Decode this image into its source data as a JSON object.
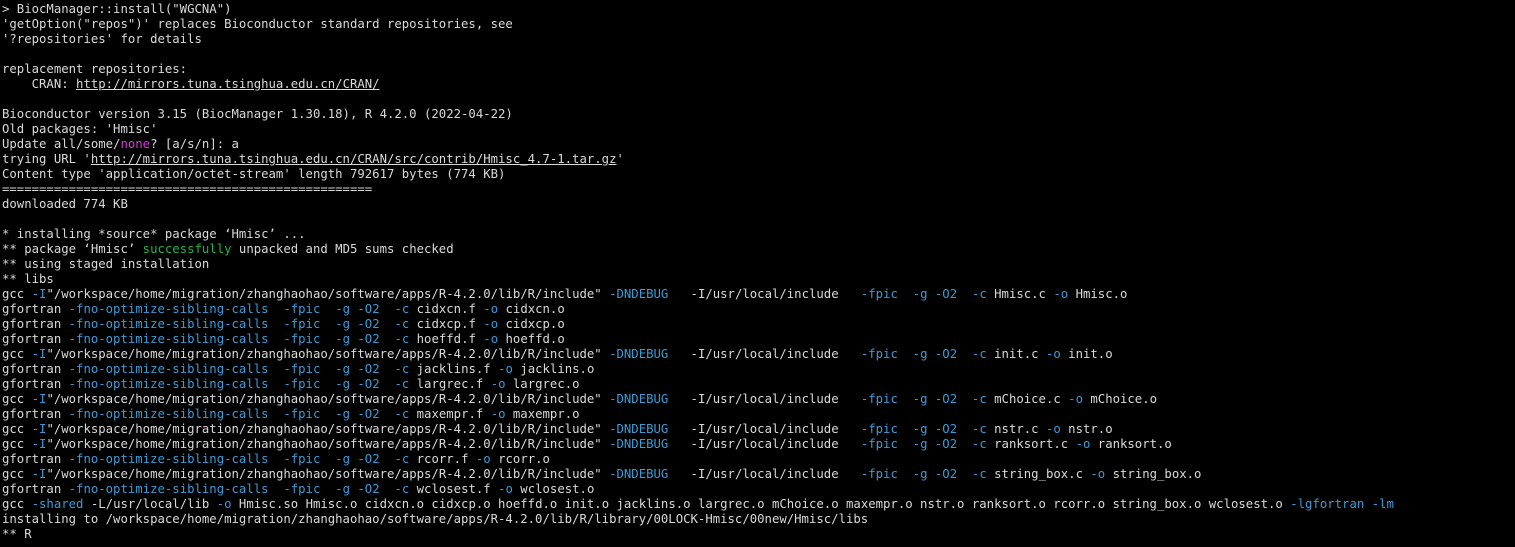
{
  "colors": {
    "background": "#000000",
    "default": "#d9d9d9",
    "flag": "#3c9bd6",
    "magenta": "#d63cd6",
    "green": "#1eb44b"
  },
  "lines": [
    [
      {
        "t": "> BiocManager::install(\"WGCNA\")"
      }
    ],
    [
      {
        "t": "'getOption(\"repos\")' replaces Bioconductor standard repositories, see"
      }
    ],
    [
      {
        "t": "'?repositories' for details"
      }
    ],
    [
      {
        "t": ""
      }
    ],
    [
      {
        "t": "replacement repositories:"
      }
    ],
    [
      {
        "t": "    CRAN: "
      },
      {
        "t": "http://mirrors.tuna.tsinghua.edu.cn/CRAN/",
        "u": true
      }
    ],
    [
      {
        "t": ""
      }
    ],
    [
      {
        "t": "Bioconductor version 3.15 (BiocManager 1.30.18), R 4.2.0 (2022-04-22)"
      }
    ],
    [
      {
        "t": "Old packages: 'Hmisc'"
      }
    ],
    [
      {
        "t": "Update all/some/"
      },
      {
        "t": "none",
        "c": "magenta"
      },
      {
        "t": "? [a/s/n]: a"
      }
    ],
    [
      {
        "t": "trying URL '"
      },
      {
        "t": "http://mirrors.tuna.tsinghua.edu.cn/CRAN/src/contrib/Hmisc_4.7-1.tar.gz",
        "u": true
      },
      {
        "t": "'"
      }
    ],
    [
      {
        "t": "Content type 'application/octet-stream' length 792617 bytes (774 KB)"
      }
    ],
    [
      {
        "t": "=================================================="
      }
    ],
    [
      {
        "t": "downloaded 774 KB"
      }
    ],
    [
      {
        "t": ""
      }
    ],
    [
      {
        "t": "* installing *source* package ‘Hmisc’ ..."
      }
    ],
    [
      {
        "t": "** package ‘Hmisc’ "
      },
      {
        "t": "successfully",
        "c": "green"
      },
      {
        "t": " unpacked and MD5 sums checked"
      }
    ],
    [
      {
        "t": "** using staged installation"
      }
    ],
    [
      {
        "t": "** libs"
      }
    ],
    [
      {
        "t": "gcc "
      },
      {
        "t": "-I",
        "c": "flag"
      },
      {
        "t": "\"/workspace/home/migration/zhanghaohao/software/apps/R-4.2.0/lib/R/include\" "
      },
      {
        "t": "-DNDEBUG",
        "c": "flag"
      },
      {
        "t": "   -I/usr/local/include   "
      },
      {
        "t": "-fpic",
        "c": "flag"
      },
      {
        "t": "  "
      },
      {
        "t": "-g",
        "c": "flag"
      },
      {
        "t": " "
      },
      {
        "t": "-O2",
        "c": "flag"
      },
      {
        "t": "  "
      },
      {
        "t": "-c",
        "c": "flag"
      },
      {
        "t": " Hmisc.c "
      },
      {
        "t": "-o",
        "c": "flag"
      },
      {
        "t": " Hmisc.o"
      }
    ],
    [
      {
        "t": "gfortran "
      },
      {
        "t": "-fno-optimize-sibling-calls",
        "c": "flag"
      },
      {
        "t": "  "
      },
      {
        "t": "-fpic",
        "c": "flag"
      },
      {
        "t": "  "
      },
      {
        "t": "-g",
        "c": "flag"
      },
      {
        "t": " "
      },
      {
        "t": "-O2",
        "c": "flag"
      },
      {
        "t": "  "
      },
      {
        "t": "-c",
        "c": "flag"
      },
      {
        "t": " cidxcn.f "
      },
      {
        "t": "-o",
        "c": "flag"
      },
      {
        "t": " cidxcn.o"
      }
    ],
    [
      {
        "t": "gfortran "
      },
      {
        "t": "-fno-optimize-sibling-calls",
        "c": "flag"
      },
      {
        "t": "  "
      },
      {
        "t": "-fpic",
        "c": "flag"
      },
      {
        "t": "  "
      },
      {
        "t": "-g",
        "c": "flag"
      },
      {
        "t": " "
      },
      {
        "t": "-O2",
        "c": "flag"
      },
      {
        "t": "  "
      },
      {
        "t": "-c",
        "c": "flag"
      },
      {
        "t": " cidxcp.f "
      },
      {
        "t": "-o",
        "c": "flag"
      },
      {
        "t": " cidxcp.o"
      }
    ],
    [
      {
        "t": "gfortran "
      },
      {
        "t": "-fno-optimize-sibling-calls",
        "c": "flag"
      },
      {
        "t": "  "
      },
      {
        "t": "-fpic",
        "c": "flag"
      },
      {
        "t": "  "
      },
      {
        "t": "-g",
        "c": "flag"
      },
      {
        "t": " "
      },
      {
        "t": "-O2",
        "c": "flag"
      },
      {
        "t": "  "
      },
      {
        "t": "-c",
        "c": "flag"
      },
      {
        "t": " hoeffd.f "
      },
      {
        "t": "-o",
        "c": "flag"
      },
      {
        "t": " hoeffd.o"
      }
    ],
    [
      {
        "t": "gcc "
      },
      {
        "t": "-I",
        "c": "flag"
      },
      {
        "t": "\"/workspace/home/migration/zhanghaohao/software/apps/R-4.2.0/lib/R/include\" "
      },
      {
        "t": "-DNDEBUG",
        "c": "flag"
      },
      {
        "t": "   -I/usr/local/include   "
      },
      {
        "t": "-fpic",
        "c": "flag"
      },
      {
        "t": "  "
      },
      {
        "t": "-g",
        "c": "flag"
      },
      {
        "t": " "
      },
      {
        "t": "-O2",
        "c": "flag"
      },
      {
        "t": "  "
      },
      {
        "t": "-c",
        "c": "flag"
      },
      {
        "t": " init.c "
      },
      {
        "t": "-o",
        "c": "flag"
      },
      {
        "t": " init.o"
      }
    ],
    [
      {
        "t": "gfortran "
      },
      {
        "t": "-fno-optimize-sibling-calls",
        "c": "flag"
      },
      {
        "t": "  "
      },
      {
        "t": "-fpic",
        "c": "flag"
      },
      {
        "t": "  "
      },
      {
        "t": "-g",
        "c": "flag"
      },
      {
        "t": " "
      },
      {
        "t": "-O2",
        "c": "flag"
      },
      {
        "t": "  "
      },
      {
        "t": "-c",
        "c": "flag"
      },
      {
        "t": " jacklins.f "
      },
      {
        "t": "-o",
        "c": "flag"
      },
      {
        "t": " jacklins.o"
      }
    ],
    [
      {
        "t": "gfortran "
      },
      {
        "t": "-fno-optimize-sibling-calls",
        "c": "flag"
      },
      {
        "t": "  "
      },
      {
        "t": "-fpic",
        "c": "flag"
      },
      {
        "t": "  "
      },
      {
        "t": "-g",
        "c": "flag"
      },
      {
        "t": " "
      },
      {
        "t": "-O2",
        "c": "flag"
      },
      {
        "t": "  "
      },
      {
        "t": "-c",
        "c": "flag"
      },
      {
        "t": " largrec.f "
      },
      {
        "t": "-o",
        "c": "flag"
      },
      {
        "t": " largrec.o"
      }
    ],
    [
      {
        "t": "gcc "
      },
      {
        "t": "-I",
        "c": "flag"
      },
      {
        "t": "\"/workspace/home/migration/zhanghaohao/software/apps/R-4.2.0/lib/R/include\" "
      },
      {
        "t": "-DNDEBUG",
        "c": "flag"
      },
      {
        "t": "   -I/usr/local/include   "
      },
      {
        "t": "-fpic",
        "c": "flag"
      },
      {
        "t": "  "
      },
      {
        "t": "-g",
        "c": "flag"
      },
      {
        "t": " "
      },
      {
        "t": "-O2",
        "c": "flag"
      },
      {
        "t": "  "
      },
      {
        "t": "-c",
        "c": "flag"
      },
      {
        "t": " mChoice.c "
      },
      {
        "t": "-o",
        "c": "flag"
      },
      {
        "t": " mChoice.o"
      }
    ],
    [
      {
        "t": "gfortran "
      },
      {
        "t": "-fno-optimize-sibling-calls",
        "c": "flag"
      },
      {
        "t": "  "
      },
      {
        "t": "-fpic",
        "c": "flag"
      },
      {
        "t": "  "
      },
      {
        "t": "-g",
        "c": "flag"
      },
      {
        "t": " "
      },
      {
        "t": "-O2",
        "c": "flag"
      },
      {
        "t": "  "
      },
      {
        "t": "-c",
        "c": "flag"
      },
      {
        "t": " maxempr.f "
      },
      {
        "t": "-o",
        "c": "flag"
      },
      {
        "t": " maxempr.o"
      }
    ],
    [
      {
        "t": "gcc "
      },
      {
        "t": "-I",
        "c": "flag"
      },
      {
        "t": "\"/workspace/home/migration/zhanghaohao/software/apps/R-4.2.0/lib/R/include\" "
      },
      {
        "t": "-DNDEBUG",
        "c": "flag"
      },
      {
        "t": "   -I/usr/local/include   "
      },
      {
        "t": "-fpic",
        "c": "flag"
      },
      {
        "t": "  "
      },
      {
        "t": "-g",
        "c": "flag"
      },
      {
        "t": " "
      },
      {
        "t": "-O2",
        "c": "flag"
      },
      {
        "t": "  "
      },
      {
        "t": "-c",
        "c": "flag"
      },
      {
        "t": " nstr.c "
      },
      {
        "t": "-o",
        "c": "flag"
      },
      {
        "t": " nstr.o"
      }
    ],
    [
      {
        "t": "gcc "
      },
      {
        "t": "-I",
        "c": "flag"
      },
      {
        "t": "\"/workspace/home/migration/zhanghaohao/software/apps/R-4.2.0/lib/R/include\" "
      },
      {
        "t": "-DNDEBUG",
        "c": "flag"
      },
      {
        "t": "   -I/usr/local/include   "
      },
      {
        "t": "-fpic",
        "c": "flag"
      },
      {
        "t": "  "
      },
      {
        "t": "-g",
        "c": "flag"
      },
      {
        "t": " "
      },
      {
        "t": "-O2",
        "c": "flag"
      },
      {
        "t": "  "
      },
      {
        "t": "-c",
        "c": "flag"
      },
      {
        "t": " ranksort.c "
      },
      {
        "t": "-o",
        "c": "flag"
      },
      {
        "t": " ranksort.o"
      }
    ],
    [
      {
        "t": "gfortran "
      },
      {
        "t": "-fno-optimize-sibling-calls",
        "c": "flag"
      },
      {
        "t": "  "
      },
      {
        "t": "-fpic",
        "c": "flag"
      },
      {
        "t": "  "
      },
      {
        "t": "-g",
        "c": "flag"
      },
      {
        "t": " "
      },
      {
        "t": "-O2",
        "c": "flag"
      },
      {
        "t": "  "
      },
      {
        "t": "-c",
        "c": "flag"
      },
      {
        "t": " rcorr.f "
      },
      {
        "t": "-o",
        "c": "flag"
      },
      {
        "t": " rcorr.o"
      }
    ],
    [
      {
        "t": "gcc "
      },
      {
        "t": "-I",
        "c": "flag"
      },
      {
        "t": "\"/workspace/home/migration/zhanghaohao/software/apps/R-4.2.0/lib/R/include\" "
      },
      {
        "t": "-DNDEBUG",
        "c": "flag"
      },
      {
        "t": "   -I/usr/local/include   "
      },
      {
        "t": "-fpic",
        "c": "flag"
      },
      {
        "t": "  "
      },
      {
        "t": "-g",
        "c": "flag"
      },
      {
        "t": " "
      },
      {
        "t": "-O2",
        "c": "flag"
      },
      {
        "t": "  "
      },
      {
        "t": "-c",
        "c": "flag"
      },
      {
        "t": " string_box.c "
      },
      {
        "t": "-o",
        "c": "flag"
      },
      {
        "t": " string_box.o"
      }
    ],
    [
      {
        "t": "gfortran "
      },
      {
        "t": "-fno-optimize-sibling-calls",
        "c": "flag"
      },
      {
        "t": "  "
      },
      {
        "t": "-fpic",
        "c": "flag"
      },
      {
        "t": "  "
      },
      {
        "t": "-g",
        "c": "flag"
      },
      {
        "t": " "
      },
      {
        "t": "-O2",
        "c": "flag"
      },
      {
        "t": "  "
      },
      {
        "t": "-c",
        "c": "flag"
      },
      {
        "t": " wclosest.f "
      },
      {
        "t": "-o",
        "c": "flag"
      },
      {
        "t": " wclosest.o"
      }
    ],
    [
      {
        "t": "gcc "
      },
      {
        "t": "-shared",
        "c": "flag"
      },
      {
        "t": " -L/usr/local/lib "
      },
      {
        "t": "-o",
        "c": "flag"
      },
      {
        "t": " Hmisc.so Hmisc.o cidxcn.o cidxcp.o hoeffd.o init.o jacklins.o largrec.o mChoice.o maxempr.o nstr.o ranksort.o rcorr.o string_box.o wclosest.o "
      },
      {
        "t": "-lgfortran",
        "c": "flag"
      },
      {
        "t": " "
      },
      {
        "t": "-lm",
        "c": "flag"
      }
    ],
    [
      {
        "t": "installing to /workspace/home/migration/zhanghaohao/software/apps/R-4.2.0/lib/R/library/00LOCK-Hmisc/00new/Hmisc/libs"
      }
    ],
    [
      {
        "t": "** R"
      }
    ]
  ]
}
